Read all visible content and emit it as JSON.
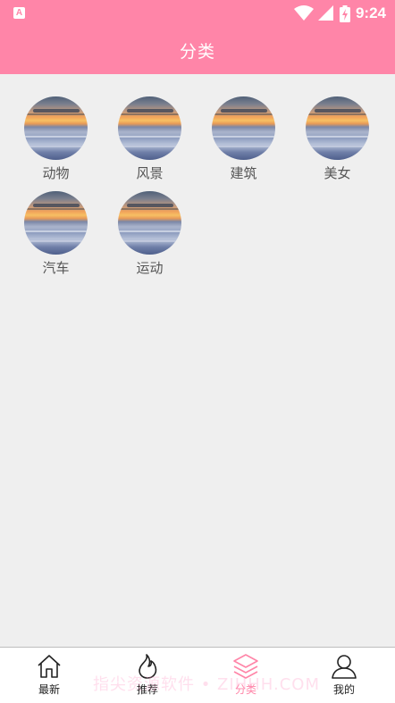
{
  "status_bar": {
    "time": "9:24",
    "app_icon": "A"
  },
  "app_bar": {
    "title": "分类"
  },
  "categories": [
    {
      "label": "动物"
    },
    {
      "label": "风景"
    },
    {
      "label": "建筑"
    },
    {
      "label": "美女"
    },
    {
      "label": "汽车"
    },
    {
      "label": "运动"
    }
  ],
  "bottom_nav": [
    {
      "label": "最新",
      "icon": "home-icon",
      "active": false
    },
    {
      "label": "推荐",
      "icon": "flame-icon",
      "active": false
    },
    {
      "label": "分类",
      "icon": "layers-icon",
      "active": true
    },
    {
      "label": "我的",
      "icon": "user-icon",
      "active": false
    }
  ],
  "watermark": "指尖资源软件 • ZIHHH.COM",
  "colors": {
    "accent": "#ff85a8",
    "background": "#efefef"
  }
}
